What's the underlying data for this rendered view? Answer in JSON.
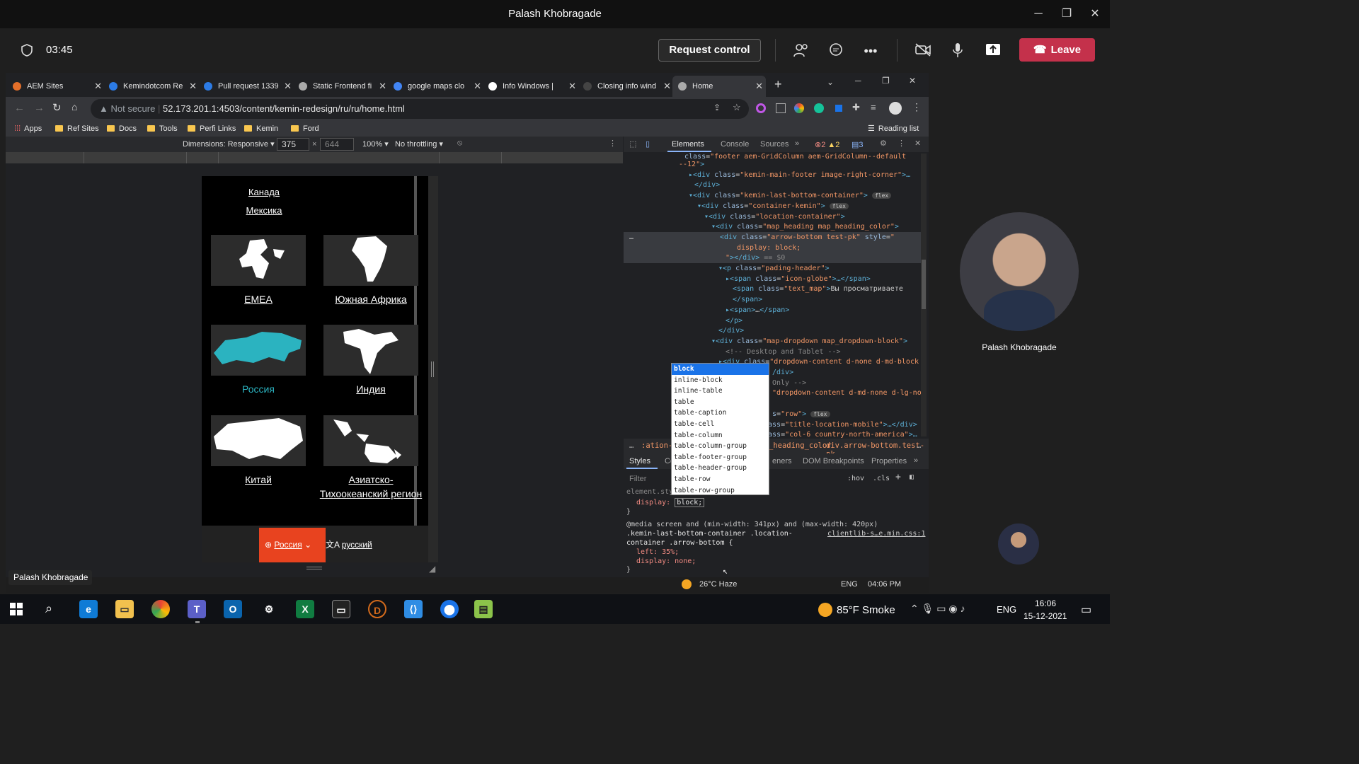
{
  "teams": {
    "title": "Palash Khobragade",
    "timer": "03:45",
    "request_control": "Request control",
    "leave": "Leave",
    "participant_name": "Palash Khobragade",
    "name_overlay": "Palash Khobragade"
  },
  "chrome": {
    "tabs": [
      "AEM Sites",
      "Kemindotcom Re",
      "Pull request 1339",
      "Static Frontend fi",
      "google maps clo",
      "Info Windows | ",
      "Closing info wind",
      "Home"
    ],
    "not_secure": "Not secure",
    "url": "52.173.201.1:4503/content/kemin-redesign/ru/ru/home.html",
    "bookmarks": [
      "Apps",
      "Ref Sites",
      "Docs",
      "Tools",
      "Perfi Links",
      "Kemin",
      "Ford"
    ],
    "reading_list": "Reading list"
  },
  "device": {
    "dimensions": "Dimensions: Responsive",
    "width": "375",
    "height": "644",
    "zoom": "100%",
    "throttle": "No throttling"
  },
  "phone": {
    "countries": [
      "Канада",
      "Мексика"
    ],
    "regions": [
      "EMEA",
      "Южная Африка",
      "Россия",
      "Индия",
      "Китай",
      "Азиатско-Тихоокеанский регион"
    ],
    "country_button": "Россия",
    "language": "русский"
  },
  "devtools": {
    "tabs": [
      "Elements",
      "Console",
      "Sources"
    ],
    "errors": "2",
    "warnings": "2",
    "messages": "3",
    "autocomplete": [
      "block",
      "inline-block",
      "inline-table",
      "table",
      "table-caption",
      "table-cell",
      "table-column",
      "table-column-group",
      "table-footer-group",
      "table-header-group",
      "table-row",
      "table-row-group"
    ],
    "crumbs": [
      ":ation-cor",
      "_heading_color",
      "div.arrow-bottom.test-pk"
    ],
    "style_tabs": [
      "Styles",
      "Con",
      "eners",
      "DOM Breakpoints",
      "Properties"
    ],
    "filter": "Filter",
    "hov": ":hov",
    "cls": ".cls",
    "element_style": "element.style {",
    "display_prop": "display:",
    "display_val": "block;",
    "media": "@media screen and (min-width: 341px) and (max-width: 420px)",
    "selector": ".kemin-last-bottom-container .location-container .arrow-bottom {",
    "source": "clientlib-s…e.min.css:1",
    "rule1": "left: 35%;",
    "rule2": "display: none;"
  },
  "taskbar": {
    "weather_inner": "26°C Haze",
    "lang_inner": "ENG",
    "time_inner": "04:06 PM",
    "weather": "85°F Smoke",
    "lang": "ENG",
    "time": "16:06",
    "date": "15-12-2021"
  }
}
